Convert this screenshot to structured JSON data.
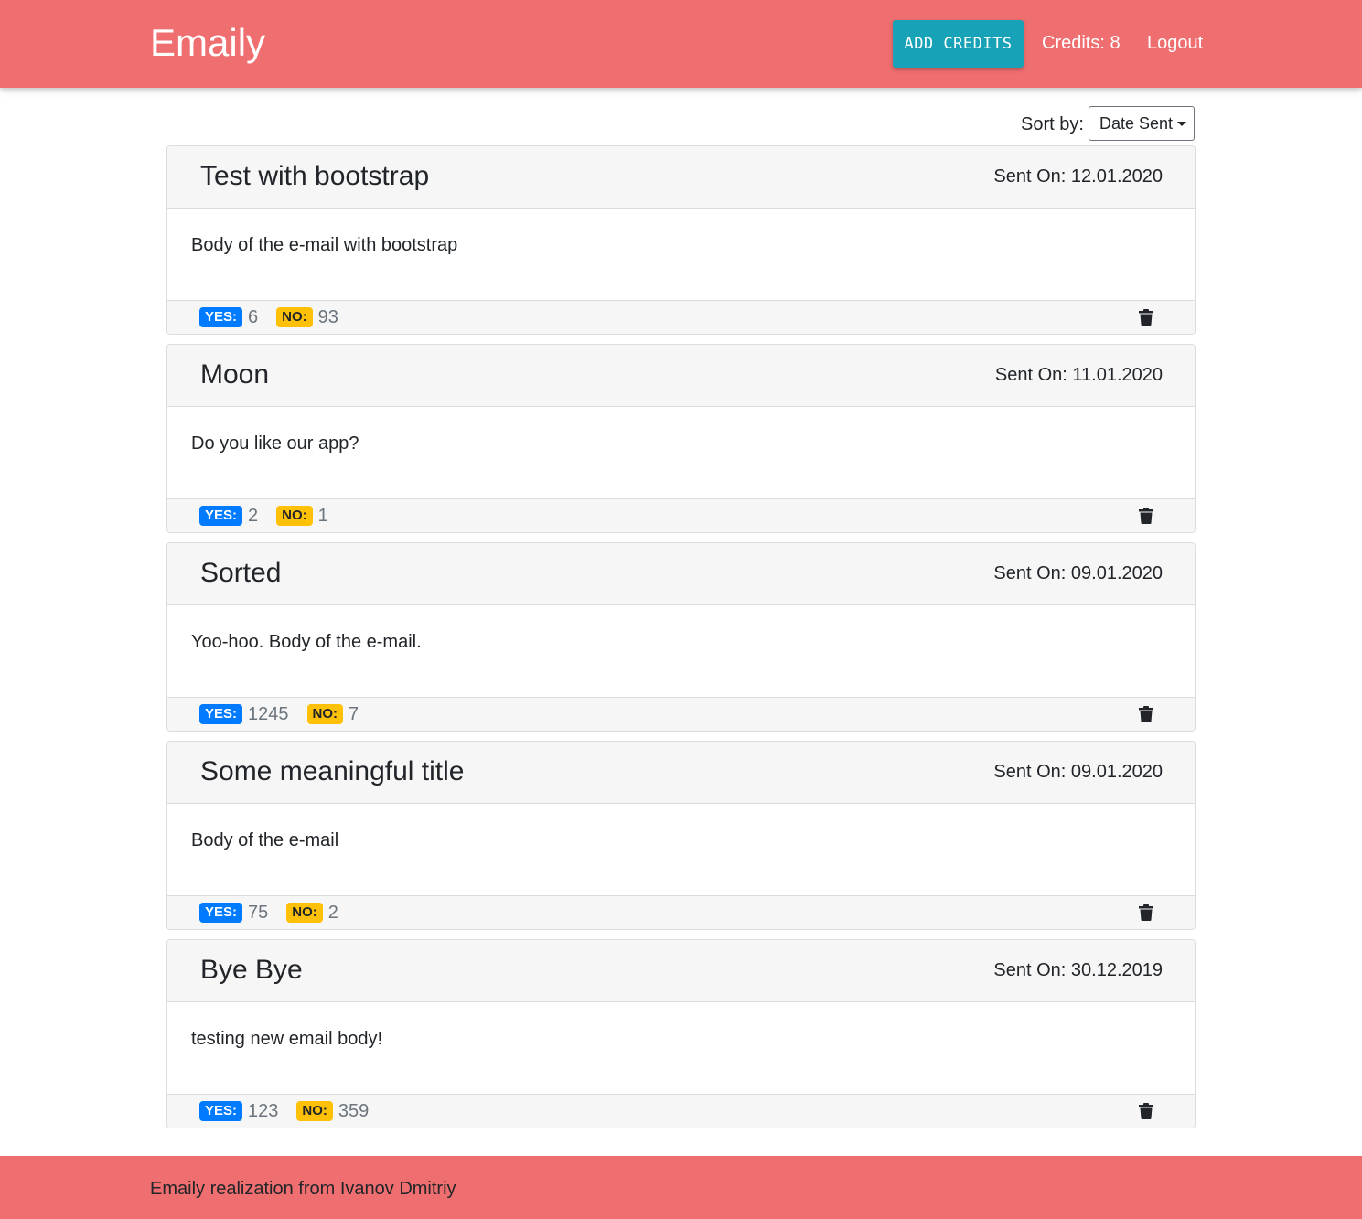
{
  "navbar": {
    "brand": "Emaily",
    "add_credits_label": "ADD CREDITS",
    "credits_text": "Credits: 8",
    "logout_label": "Logout"
  },
  "sort": {
    "label": "Sort by:",
    "selected": "Date Sent"
  },
  "surveys": [
    {
      "title": "Test with bootstrap",
      "sent_on": "Sent On: 12.01.2020",
      "body": "Body of the e-mail with bootstrap",
      "yes_label": "YES:",
      "yes": "6",
      "no_label": "NO:",
      "no": "93"
    },
    {
      "title": "Moon",
      "sent_on": "Sent On: 11.01.2020",
      "body": "Do you like our app?",
      "yes_label": "YES:",
      "yes": "2",
      "no_label": "NO:",
      "no": "1"
    },
    {
      "title": "Sorted",
      "sent_on": "Sent On: 09.01.2020",
      "body": "Yoo-hoo. Body of the e-mail.",
      "yes_label": "YES:",
      "yes": "1245",
      "no_label": "NO:",
      "no": "7"
    },
    {
      "title": "Some meaningful title",
      "sent_on": "Sent On: 09.01.2020",
      "body": "Body of the e-mail",
      "yes_label": "YES:",
      "yes": "75",
      "no_label": "NO:",
      "no": "2"
    },
    {
      "title": "Bye Bye",
      "sent_on": "Sent On: 30.12.2019",
      "body": "testing new email body!",
      "yes_label": "YES:",
      "yes": "123",
      "no_label": "NO:",
      "no": "359"
    }
  ],
  "icons": {
    "delete": "trash-icon",
    "dropdown": "caret-down-icon"
  },
  "colors": {
    "brand": "#ef6e6f",
    "add_credits": "#17a2b8",
    "yes_badge": "#007bff",
    "no_badge": "#ffc107"
  },
  "footer": {
    "text": "Emaily realization from Ivanov Dmitriy"
  }
}
